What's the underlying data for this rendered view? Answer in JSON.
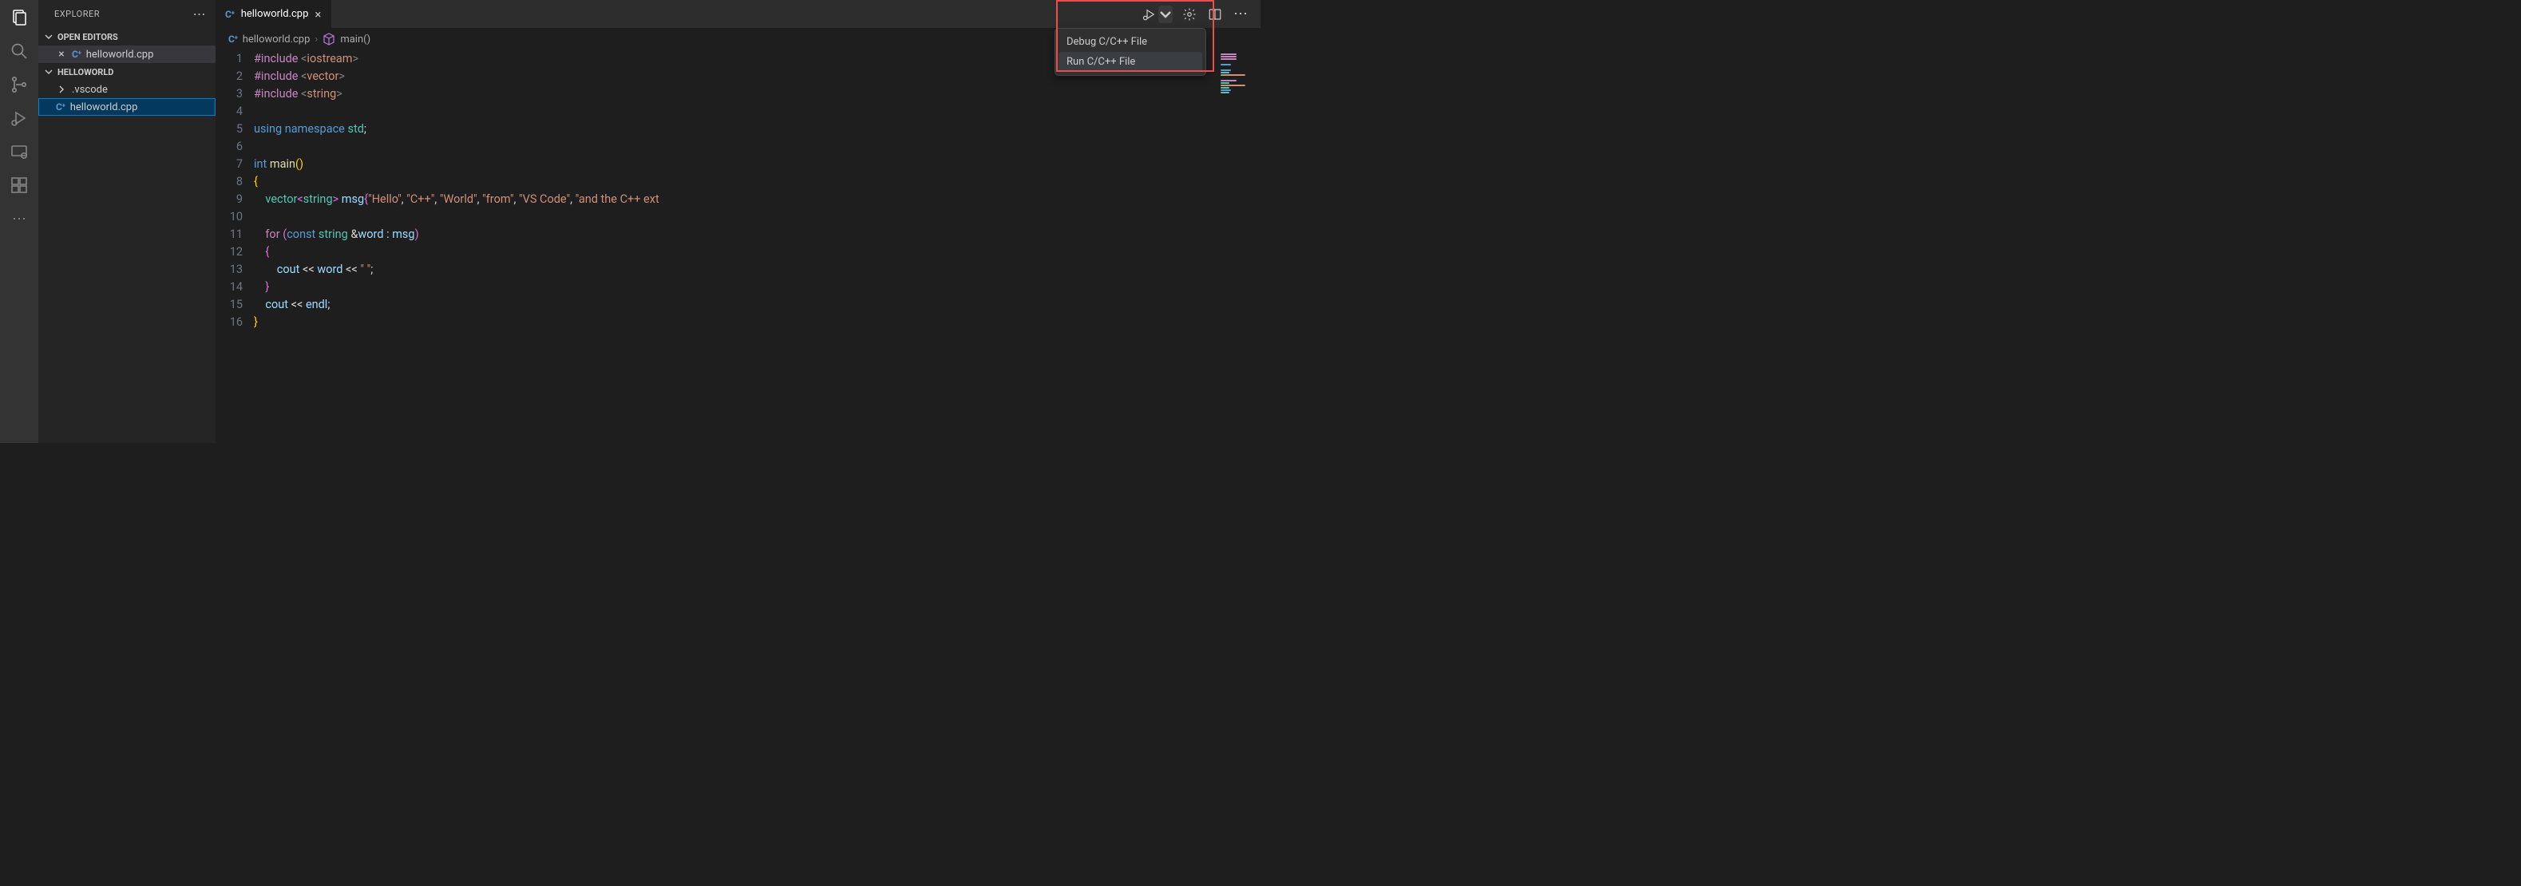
{
  "sidebar": {
    "title": "EXPLORER",
    "sections": {
      "open_editors": {
        "label": "OPEN EDITORS",
        "items": [
          {
            "name": "helloworld.cpp",
            "icon": "cpp"
          }
        ]
      },
      "workspace": {
        "label": "HELLOWORLD",
        "items": [
          {
            "name": ".vscode",
            "kind": "folder",
            "expanded": false
          },
          {
            "name": "helloworld.cpp",
            "kind": "file",
            "selected": true,
            "icon": "cpp"
          }
        ]
      }
    }
  },
  "tabs": [
    {
      "name": "helloworld.cpp",
      "icon": "cpp",
      "active": true
    }
  ],
  "breadcrumbs": [
    {
      "label": "helloworld.cpp",
      "icon": "cpp"
    },
    {
      "label": "main()",
      "icon": "symbol-method"
    }
  ],
  "run_menu": {
    "items": [
      {
        "label": "Debug C/C++ File"
      },
      {
        "label": "Run C/C++ File",
        "hover": true
      }
    ]
  },
  "code": {
    "lines": [
      [
        {
          "c": "pp",
          "t": "#include "
        },
        {
          "c": "lt",
          "t": "<"
        },
        {
          "c": "st",
          "t": "iostream"
        },
        {
          "c": "lt",
          "t": ">"
        }
      ],
      [
        {
          "c": "pp",
          "t": "#include "
        },
        {
          "c": "lt",
          "t": "<"
        },
        {
          "c": "st",
          "t": "vector"
        },
        {
          "c": "lt",
          "t": ">"
        }
      ],
      [
        {
          "c": "pp",
          "t": "#include "
        },
        {
          "c": "lt",
          "t": "<"
        },
        {
          "c": "st",
          "t": "string"
        },
        {
          "c": "lt",
          "t": ">"
        }
      ],
      [],
      [
        {
          "c": "kw",
          "t": "using"
        },
        {
          "c": "pl",
          "t": " "
        },
        {
          "c": "kw",
          "t": "namespace"
        },
        {
          "c": "pl",
          "t": " "
        },
        {
          "c": "ty",
          "t": "std"
        },
        {
          "c": "pl",
          "t": ";"
        }
      ],
      [],
      [
        {
          "c": "kw",
          "t": "int"
        },
        {
          "c": "pl",
          "t": " "
        },
        {
          "c": "fn",
          "t": "main"
        },
        {
          "c": "br",
          "t": "()"
        }
      ],
      [
        {
          "c": "br",
          "t": "{"
        }
      ],
      [
        {
          "c": "pl",
          "t": "    "
        },
        {
          "c": "ty",
          "t": "vector"
        },
        {
          "c": "br2",
          "t": "<"
        },
        {
          "c": "ty",
          "t": "string"
        },
        {
          "c": "br2",
          "t": ">"
        },
        {
          "c": "pl",
          "t": " "
        },
        {
          "c": "vr",
          "t": "msg"
        },
        {
          "c": "br2",
          "t": "{"
        },
        {
          "c": "st",
          "t": "\"Hello\""
        },
        {
          "c": "pl",
          "t": ", "
        },
        {
          "c": "st",
          "t": "\"C++\""
        },
        {
          "c": "pl",
          "t": ", "
        },
        {
          "c": "st",
          "t": "\"World\""
        },
        {
          "c": "pl",
          "t": ", "
        },
        {
          "c": "st",
          "t": "\"from\""
        },
        {
          "c": "pl",
          "t": ", "
        },
        {
          "c": "st",
          "t": "\"VS Code\""
        },
        {
          "c": "pl",
          "t": ", "
        },
        {
          "c": "st",
          "t": "\"and the C++ ext"
        }
      ],
      [],
      [
        {
          "c": "pl",
          "t": "    "
        },
        {
          "c": "pp",
          "t": "for"
        },
        {
          "c": "pl",
          "t": " "
        },
        {
          "c": "br2",
          "t": "("
        },
        {
          "c": "kw",
          "t": "const"
        },
        {
          "c": "pl",
          "t": " "
        },
        {
          "c": "ty",
          "t": "string"
        },
        {
          "c": "pl",
          "t": " &"
        },
        {
          "c": "vr",
          "t": "word"
        },
        {
          "c": "pl",
          "t": " : "
        },
        {
          "c": "vr",
          "t": "msg"
        },
        {
          "c": "br2",
          "t": ")"
        }
      ],
      [
        {
          "c": "pl",
          "t": "    "
        },
        {
          "c": "br2",
          "t": "{"
        }
      ],
      [
        {
          "c": "pl",
          "t": "        "
        },
        {
          "c": "vr",
          "t": "cout"
        },
        {
          "c": "pl",
          "t": " << "
        },
        {
          "c": "vr",
          "t": "word"
        },
        {
          "c": "pl",
          "t": " << "
        },
        {
          "c": "st",
          "t": "\" \""
        },
        {
          "c": "pl",
          "t": ";"
        }
      ],
      [
        {
          "c": "pl",
          "t": "    "
        },
        {
          "c": "br2",
          "t": "}"
        }
      ],
      [
        {
          "c": "pl",
          "t": "    "
        },
        {
          "c": "vr",
          "t": "cout"
        },
        {
          "c": "pl",
          "t": " << "
        },
        {
          "c": "vr",
          "t": "endl"
        },
        {
          "c": "pl",
          "t": ";"
        }
      ],
      [
        {
          "c": "br",
          "t": "}"
        }
      ]
    ]
  },
  "icons": {
    "cpp_glyph": "C⁺"
  }
}
